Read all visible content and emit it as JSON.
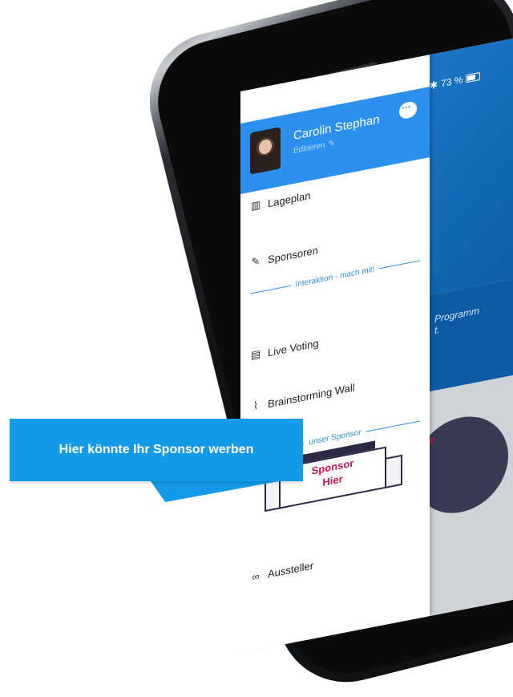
{
  "status_bar": {
    "bluetooth_icon": "bluetooth-icon",
    "battery": "73 %"
  },
  "drawer": {
    "user_name": "Carolin Stephan",
    "edit_label": "Editieren",
    "menu": [
      {
        "label": "Lageplan",
        "icon": "map-icon"
      },
      {
        "label": "Sponsoren",
        "icon": "pin-icon"
      },
      {
        "label": "Live Voting",
        "icon": "document-icon"
      },
      {
        "label": "Brainstorming Wall",
        "icon": "paperclip-icon"
      },
      {
        "label": "Aussteller",
        "icon": "link-icon"
      }
    ],
    "section_interaktion": "Interaktion - mach mit!",
    "section_sponsor": "unser Sponsor",
    "banner_line1": "Sponsor",
    "banner_line2": "Hier"
  },
  "background_app": {
    "program_text_line1": "Programm",
    "program_text_line2": "t."
  },
  "callout": {
    "text": "Hier könnte Ihr Sponsor werben"
  },
  "colors": {
    "accent": "#2c90ee",
    "callout": "#139ae9",
    "sponsor_text": "#c2185b",
    "banner_dark": "#2b2a45"
  }
}
